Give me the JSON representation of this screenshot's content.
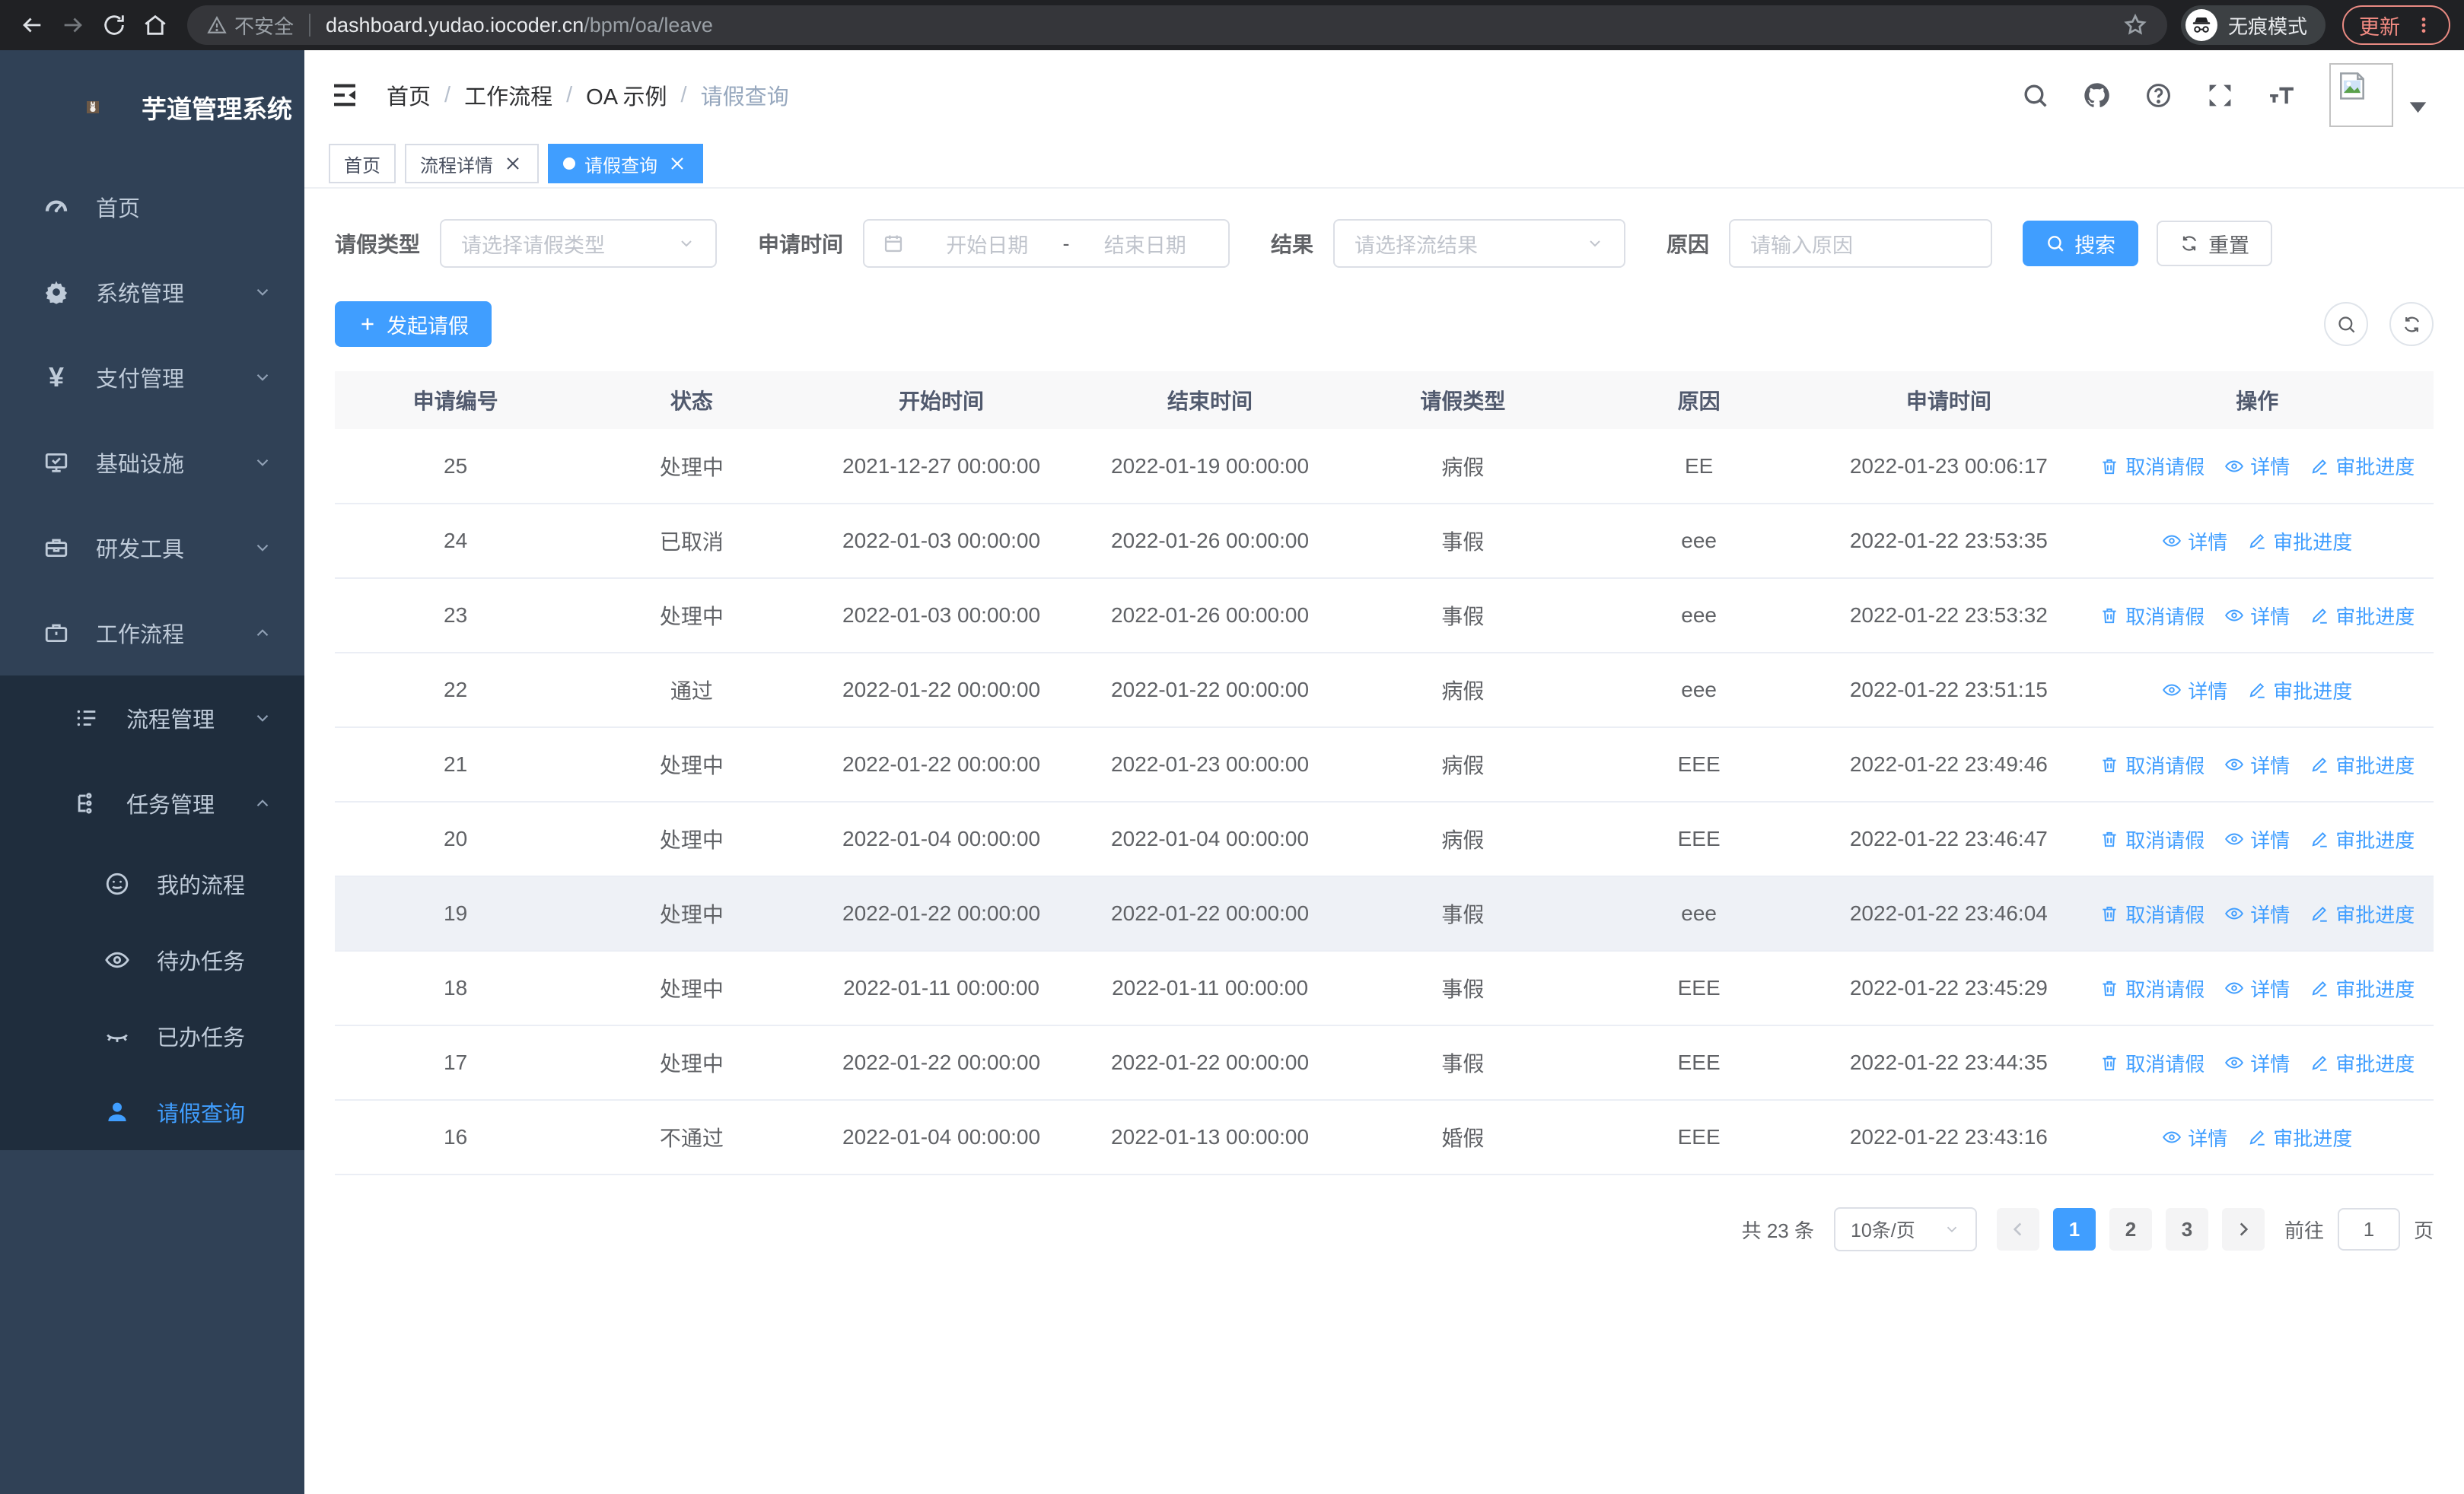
{
  "colors": {
    "accent": "#409eff",
    "sidebar_bg": "#304156",
    "submenu_bg": "#1f2d3d",
    "update_red": "#f28b82",
    "row_highlight": "#eef1f6"
  },
  "browser": {
    "warning_label": "不安全",
    "url_host": "dashboard.yudao.iocoder.cn",
    "url_path": "/bpm/oa/leave",
    "incognito_label": "无痕模式",
    "update_label": "更新"
  },
  "sidebar": {
    "title": "芋道管理系统",
    "items": [
      {
        "key": "home",
        "icon": "dashboard",
        "label": "首页"
      },
      {
        "key": "system",
        "icon": "gear",
        "label": "系统管理",
        "open": false
      },
      {
        "key": "payment",
        "icon": "yen",
        "label": "支付管理",
        "open": false
      },
      {
        "key": "infra",
        "icon": "infra",
        "label": "基础设施",
        "open": false
      },
      {
        "key": "devtools",
        "icon": "tools",
        "label": "研发工具",
        "open": false
      },
      {
        "key": "workflow",
        "icon": "workflow",
        "label": "工作流程",
        "open": true,
        "children": [
          {
            "key": "process-mgmt",
            "icon": "process-list",
            "label": "流程管理",
            "open": false
          },
          {
            "key": "task-mgmt",
            "icon": "task-tree",
            "label": "任务管理",
            "open": true,
            "children": [
              {
                "key": "my-process",
                "icon": "face",
                "label": "我的流程"
              },
              {
                "key": "todo-tasks",
                "icon": "eye",
                "label": "待办任务"
              },
              {
                "key": "done-tasks",
                "icon": "eye-closed",
                "label": "已办任务"
              },
              {
                "key": "leave-query",
                "icon": "user",
                "label": "请假查询",
                "active": true
              }
            ]
          }
        ]
      }
    ]
  },
  "header": {
    "breadcrumb": [
      "首页",
      "工作流程",
      "OA 示例",
      "请假查询"
    ]
  },
  "tabs": [
    {
      "label": "首页",
      "closable": false,
      "active": false
    },
    {
      "label": "流程详情",
      "closable": true,
      "active": false
    },
    {
      "label": "请假查询",
      "closable": true,
      "active": true
    }
  ],
  "filters": {
    "type_label": "请假类型",
    "type_placeholder": "请选择请假类型",
    "time_label": "申请时间",
    "start_placeholder": "开始日期",
    "range_separator": "-",
    "end_placeholder": "结束日期",
    "result_label": "结果",
    "result_placeholder": "请选择流结果",
    "reason_label": "原因",
    "reason_placeholder": "请输入原因",
    "search_label": "搜索",
    "reset_label": "重置"
  },
  "toolbar": {
    "create_label": "发起请假"
  },
  "table": {
    "columns": [
      "申请编号",
      "状态",
      "开始时间",
      "结束时间",
      "请假类型",
      "原因",
      "申请时间",
      "操作"
    ],
    "rows": [
      {
        "id": "25",
        "status": "处理中",
        "start": "2021-12-27 00:00:00",
        "end": "2022-01-19 00:00:00",
        "type": "病假",
        "reason": "EE",
        "applied": "2022-01-23 00:06:17",
        "cancelable": true,
        "highlighted": false
      },
      {
        "id": "24",
        "status": "已取消",
        "start": "2022-01-03 00:00:00",
        "end": "2022-01-26 00:00:00",
        "type": "事假",
        "reason": "eee",
        "applied": "2022-01-22 23:53:35",
        "cancelable": false,
        "highlighted": false
      },
      {
        "id": "23",
        "status": "处理中",
        "start": "2022-01-03 00:00:00",
        "end": "2022-01-26 00:00:00",
        "type": "事假",
        "reason": "eee",
        "applied": "2022-01-22 23:53:32",
        "cancelable": true,
        "highlighted": false
      },
      {
        "id": "22",
        "status": "通过",
        "start": "2022-01-22 00:00:00",
        "end": "2022-01-22 00:00:00",
        "type": "病假",
        "reason": "eee",
        "applied": "2022-01-22 23:51:15",
        "cancelable": false,
        "highlighted": false
      },
      {
        "id": "21",
        "status": "处理中",
        "start": "2022-01-22 00:00:00",
        "end": "2022-01-23 00:00:00",
        "type": "病假",
        "reason": "EEE",
        "applied": "2022-01-22 23:49:46",
        "cancelable": true,
        "highlighted": false
      },
      {
        "id": "20",
        "status": "处理中",
        "start": "2022-01-04 00:00:00",
        "end": "2022-01-04 00:00:00",
        "type": "病假",
        "reason": "EEE",
        "applied": "2022-01-22 23:46:47",
        "cancelable": true,
        "highlighted": false
      },
      {
        "id": "19",
        "status": "处理中",
        "start": "2022-01-22 00:00:00",
        "end": "2022-01-22 00:00:00",
        "type": "事假",
        "reason": "eee",
        "applied": "2022-01-22 23:46:04",
        "cancelable": true,
        "highlighted": true
      },
      {
        "id": "18",
        "status": "处理中",
        "start": "2022-01-11 00:00:00",
        "end": "2022-01-11 00:00:00",
        "type": "事假",
        "reason": "EEE",
        "applied": "2022-01-22 23:45:29",
        "cancelable": true,
        "highlighted": false
      },
      {
        "id": "17",
        "status": "处理中",
        "start": "2022-01-22 00:00:00",
        "end": "2022-01-22 00:00:00",
        "type": "事假",
        "reason": "EEE",
        "applied": "2022-01-22 23:44:35",
        "cancelable": true,
        "highlighted": false
      },
      {
        "id": "16",
        "status": "不通过",
        "start": "2022-01-04 00:00:00",
        "end": "2022-01-13 00:00:00",
        "type": "婚假",
        "reason": "EEE",
        "applied": "2022-01-22 23:43:16",
        "cancelable": false,
        "highlighted": false
      }
    ]
  },
  "row_actions": {
    "cancel": "取消请假",
    "detail": "详情",
    "progress": "审批进度"
  },
  "pagination": {
    "total": "共 23 条",
    "page_size": "10条/页",
    "pages": [
      "1",
      "2",
      "3"
    ],
    "active_page": "1",
    "goto_label": "前往",
    "goto_value": "1",
    "goto_suffix": "页"
  }
}
